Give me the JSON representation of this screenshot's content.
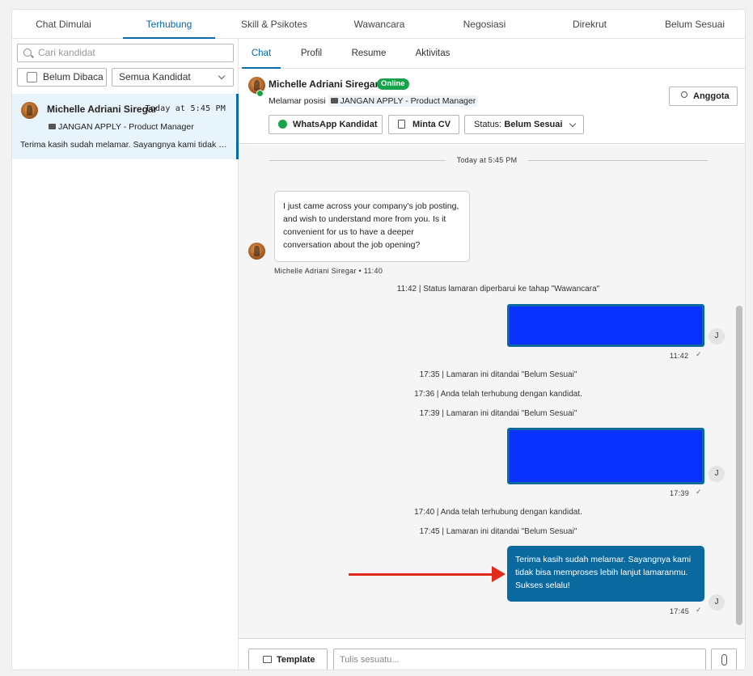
{
  "top_tabs": [
    "Chat Dimulai",
    "Terhubung",
    "Skill & Psikotes",
    "Wawancara",
    "Negosiasi",
    "Direkrut",
    "Belum Sesuai"
  ],
  "left": {
    "search_placeholder": "Cari kandidat",
    "unread_label": "Belum Dibaca",
    "filter_label": "Semua Kandidat",
    "candidate": {
      "name": "Michelle Adriani Siregar",
      "time": "Today at 5:45 PM",
      "job": "JANGAN APPLY - Product Manager",
      "preview": "Terima kasih sudah melamar. Sayangnya kami tidak bisa memproses lebih lanjut lamaranmu. Sukses selalu!"
    }
  },
  "sub_tabs": [
    "Chat",
    "Profil",
    "Resume",
    "Aktivitas"
  ],
  "header": {
    "name": "Michelle Adriani Siregar",
    "online": "Online",
    "position_label": "Melamar posisi",
    "position": "JANGAN APPLY - Product Manager",
    "whatsapp_btn": "WhatsApp Kandidat",
    "cv_btn": "Minta CV",
    "status_label": "Status:",
    "status_value": "Belum Sesuai",
    "member_btn": "Anggota"
  },
  "chat": {
    "date_divider": "Today at 5:45 PM",
    "incoming_text": "I just came across your company's job posting, and wish to understand more from you. Is it convenient for us to have a deeper conversation about the job opening?",
    "incoming_meta": "Michelle Adriani Siregar • 11:40",
    "sys1": "11:42 | Status lamaran diperbarui ke tahap \"Wawancara\"",
    "time1": "11:42",
    "sys2": "17:35 | Lamaran ini ditandai \"Belum Sesuai\"",
    "sys3": "17:36 | Anda telah terhubung dengan kandidat.",
    "sys4": "17:39 | Lamaran ini ditandai \"Belum Sesuai\"",
    "time2": "17:39",
    "sys5": "17:40 | Anda telah terhubung dengan kandidat.",
    "sys6": "17:45 | Lamaran ini ditandai \"Belum Sesuai\"",
    "outgoing_text": "Terima kasih sudah melamar. Sayangnya kami tidak bisa memproses lebih lanjut lamaranmu. Sukses selalu!",
    "time3": "17:45",
    "avatar_initial": "J",
    "tick": "✓"
  },
  "footer": {
    "template_btn": "Template",
    "input_placeholder": "Tulis sesuatu..."
  },
  "colors": {
    "accent": "#0a69a8",
    "online": "#16a34a",
    "arrow": "#e12a1a",
    "redaction": "#0a32ff"
  }
}
